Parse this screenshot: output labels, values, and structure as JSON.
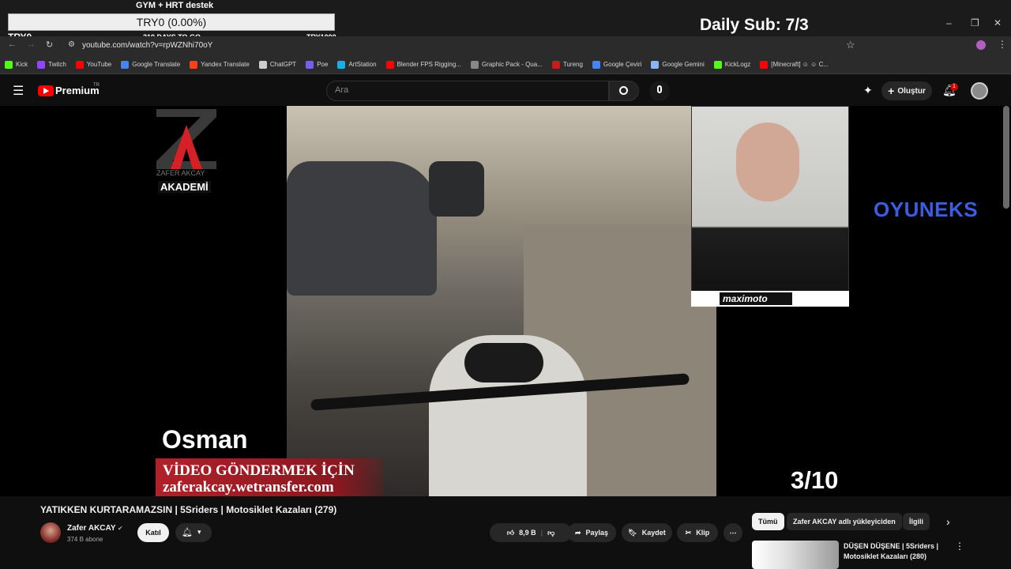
{
  "overlay": {
    "goal_title": "GYM + HRT destek",
    "goal_value": "TRY0 (0.00%)",
    "goal_left": "TRY0",
    "goal_days": "319 DAYS TO GO",
    "goal_right": "TRY1000",
    "daily_sub": "Daily Sub: 7/3"
  },
  "browser": {
    "url": "youtube.com/watch?v=rpWZNhi70oY",
    "bookmarks": [
      {
        "label": "Kick",
        "color": "#53fc18"
      },
      {
        "label": "Twitch",
        "color": "#9146ff"
      },
      {
        "label": "YouTube",
        "color": "#ff0000"
      },
      {
        "label": "Google Translate",
        "color": "#4285f4"
      },
      {
        "label": "Yandex Translate",
        "color": "#fc3f1d"
      },
      {
        "label": "ChatGPT",
        "color": "#cccccc"
      },
      {
        "label": "Poe",
        "color": "#7a5af8"
      },
      {
        "label": "ArtStation",
        "color": "#13aff0"
      },
      {
        "label": "Blender FPS Rigging...",
        "color": "#ff0000"
      },
      {
        "label": "Graphic Pack - Qua...",
        "color": "#888888"
      },
      {
        "label": "Tureng",
        "color": "#c51c1c"
      },
      {
        "label": "Google Çeviri",
        "color": "#4285f4"
      },
      {
        "label": "Google Gemini",
        "color": "#8ab4f8"
      },
      {
        "label": "KickLogz",
        "color": "#53fc18"
      },
      {
        "label": "[Minecraft] ☺ ☺ C...",
        "color": "#ff0000"
      }
    ]
  },
  "youtube": {
    "logo_text": "Premium",
    "logo_sup": "TR",
    "search_placeholder": "Ara",
    "create_label": "Oluştur",
    "notif_count": "1"
  },
  "video": {
    "brand_top": "ZAFER AKCAY",
    "brand_bottom": "AKADEMİ",
    "caption_name": "Osman",
    "caption_line1": "VİDEO GÖNDERMEK İÇİN",
    "caption_line2": "zaferakcay.wetransfer.com",
    "counter": "3/10",
    "sponsor": "OYUNEKS",
    "cam_brand": "maximoto"
  },
  "info": {
    "title": "YATIKKEN KURTARAMAZSIN | 5Sriders | Motosiklet Kazaları (279)",
    "channel": "Zafer AKCAY",
    "subs": "374 B abone",
    "join": "Katıl",
    "likes": "8,9 B",
    "share": "Paylaş",
    "save": "Kaydet",
    "clip": "Klip"
  },
  "sidebar": {
    "chips": [
      "Tümü",
      "Zafer AKCAY adlı yükleyiciden",
      "İlgili"
    ],
    "rec_title": "DÜŞEN DÜŞENE | 5Sriders | Motosiklet Kazaları (280)"
  }
}
